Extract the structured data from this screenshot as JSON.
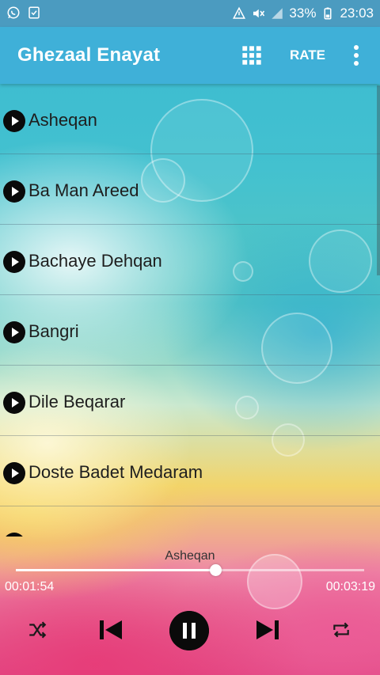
{
  "status_bar": {
    "battery": "33%",
    "time": "23:03"
  },
  "app_bar": {
    "title": "Ghezaal Enayat",
    "rate_label": "RATE"
  },
  "songs": [
    "Asheqan",
    "Ba Man Areed",
    "Bachaye Dehqan",
    "Bangri",
    "Dile Beqarar",
    "Doste Badet Medaram"
  ],
  "player": {
    "now_playing": "Asheqan",
    "current_time": "00:01:54",
    "total_time": "00:03:19",
    "progress": 0.573
  },
  "colors": {
    "app_bar": "#3fb0d8",
    "status_bar": "#4b9bc0"
  },
  "icons": {
    "whatsapp": "whatsapp-icon",
    "tasks": "checklist-icon",
    "grid": "grid-icon",
    "more": "more-vert-icon",
    "play": "play-circle-icon",
    "shuffle": "shuffle-icon",
    "previous": "skip-previous-icon",
    "pause": "pause-icon",
    "next": "skip-next-icon",
    "repeat": "repeat-icon"
  }
}
